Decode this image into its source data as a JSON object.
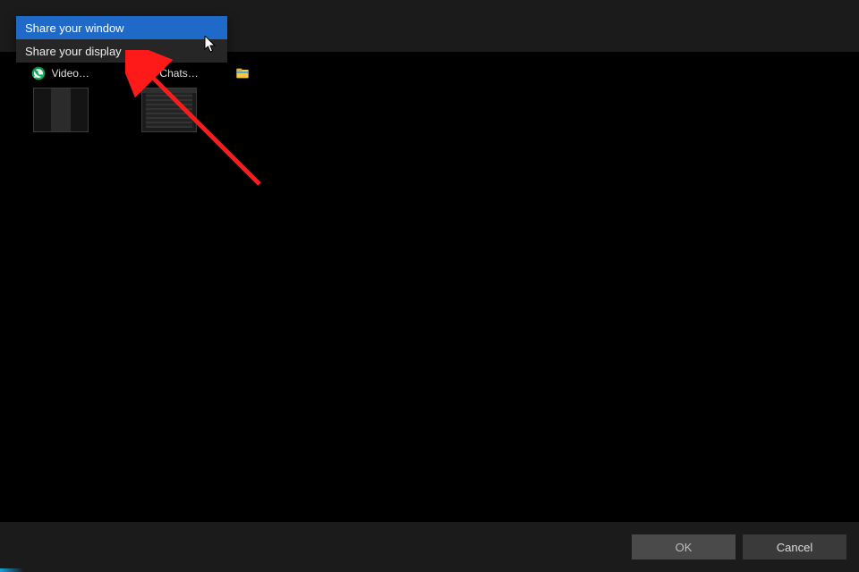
{
  "menu": {
    "items": [
      {
        "label": "Share your window",
        "hover": true
      },
      {
        "label": "Share your display",
        "hover": false
      }
    ]
  },
  "windows": {
    "items": [
      {
        "icon": "whatsapp",
        "label": "Video…"
      },
      {
        "icon": "whatsapp",
        "label": "Chats…"
      },
      {
        "icon": "file-explorer",
        "label": ""
      }
    ]
  },
  "footer": {
    "ok_label": "OK",
    "cancel_label": "Cancel"
  },
  "colors": {
    "menu_hover": "#1f69c8",
    "accent_red": "#ff1a1a"
  }
}
